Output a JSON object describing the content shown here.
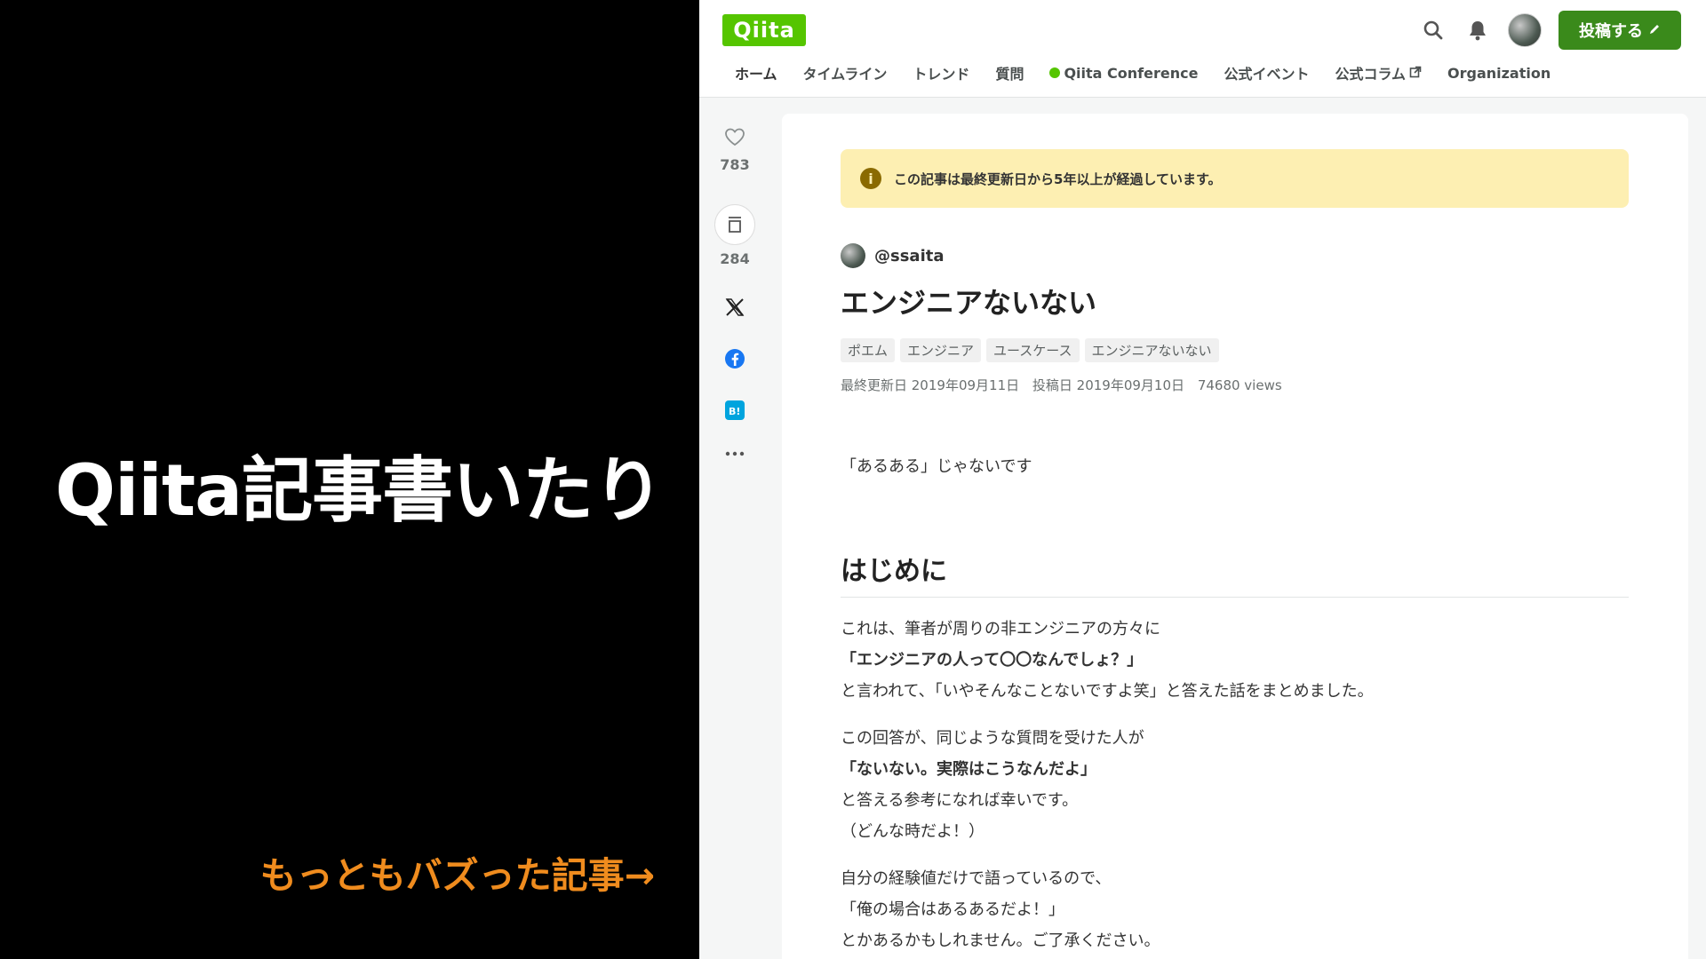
{
  "slide": {
    "title": "Qiita記事書いたり",
    "caption": "もっともバズった記事→"
  },
  "header": {
    "logo": "Qiita",
    "post_button": "投稿する",
    "icons": [
      "search-icon",
      "bell-icon",
      "avatar",
      "pencil-icon"
    ],
    "nav": [
      {
        "label": "ホーム"
      },
      {
        "label": "タイムライン"
      },
      {
        "label": "トレンド"
      },
      {
        "label": "質問"
      },
      {
        "label": "Qiita Conference"
      },
      {
        "label": "公式イベント"
      },
      {
        "label": "公式コラム"
      },
      {
        "label": "Organization"
      }
    ]
  },
  "actions": {
    "likes": "783",
    "stocks": "284"
  },
  "article": {
    "notice": "この記事は最終更新日から5年以上が経過しています。",
    "author": "@ssaita",
    "title": "エンジニアないない",
    "tags": [
      "ポエム",
      "エンジニア",
      "ユースケース",
      "エンジニアないない"
    ],
    "updated": "最終更新日 2019年09月11日",
    "posted": "投稿日 2019年09月10日",
    "views": "74680 views",
    "lead": "「あるある」じゃないです",
    "heading": "はじめに",
    "para1": {
      "l1": "これは、筆者が周りの非エンジニアの方々に",
      "l2": "「エンジニアの人って〇〇なんでしょ？」",
      "l3": "と言われて、「いやそんなことないですよ笑」と答えた話をまとめました。"
    },
    "para2": {
      "l1": "この回答が、同じような質問を受けた人が",
      "l2": "「ないない。実際はこうなんだよ」",
      "l3": "と答える参考になれば幸いです。",
      "l4": "（どんな時だよ！）"
    },
    "para3": {
      "l1": "自分の経験値だけで語っているので、",
      "l2": "「俺の場合はあるあるだよ！」",
      "l3": "とかあるかもしれません。ご了承ください。"
    }
  },
  "colors": {
    "brand": "#55c500",
    "post_button": "#3a8a1b",
    "notice_bg": "#fdefb2",
    "caption": "#f08c1e"
  }
}
